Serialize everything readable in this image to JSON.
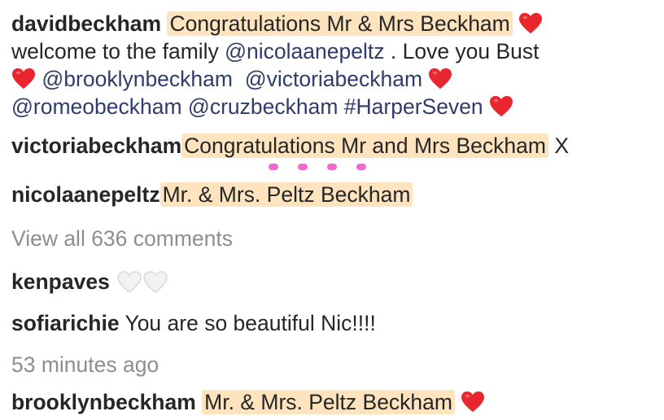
{
  "comments": [
    {
      "user": "davidbeckham",
      "highlight": "Congratulations Mr & Mrs Beckham",
      "line1_rest": "",
      "line2_a": "welcome to the family ",
      "line2_mention": "@nicolaanepeltz",
      "line2_b": " . Love you Bust",
      "line3_mention_a": "@brooklynbeckham",
      "line3_mention_b": "@victoriabeckham",
      "line4_mention_a": "@romeobeckham",
      "line4_mention_b": "@cruzbeckham",
      "line4_hashtag": "#HarperSeven"
    },
    {
      "user": "victoriabeckham",
      "highlight": "Congratulations Mr and Mrs Beckham",
      "trail": "X"
    },
    {
      "user": "nicolaanepeltz",
      "highlight": "Mr. & Mrs. Peltz Beckham"
    }
  ],
  "view_all": "View all 636 comments",
  "replies": [
    {
      "user": "kenpaves",
      "text": ""
    },
    {
      "user": "sofiarichie",
      "text": "You are so beautiful Nic!!!!"
    }
  ],
  "timestamp": "53 minutes ago",
  "last": {
    "user": "brooklynbeckham",
    "highlight": "Mr. & Mrs. Peltz Beckham"
  },
  "colors": {
    "highlight": "#fde4bf",
    "heart_red": "#e8262d",
    "mention": "#2f3d6b",
    "muted": "#8e8e8e"
  },
  "icons": {
    "red": "red-heart-icon",
    "white": "white-heart-icon"
  }
}
